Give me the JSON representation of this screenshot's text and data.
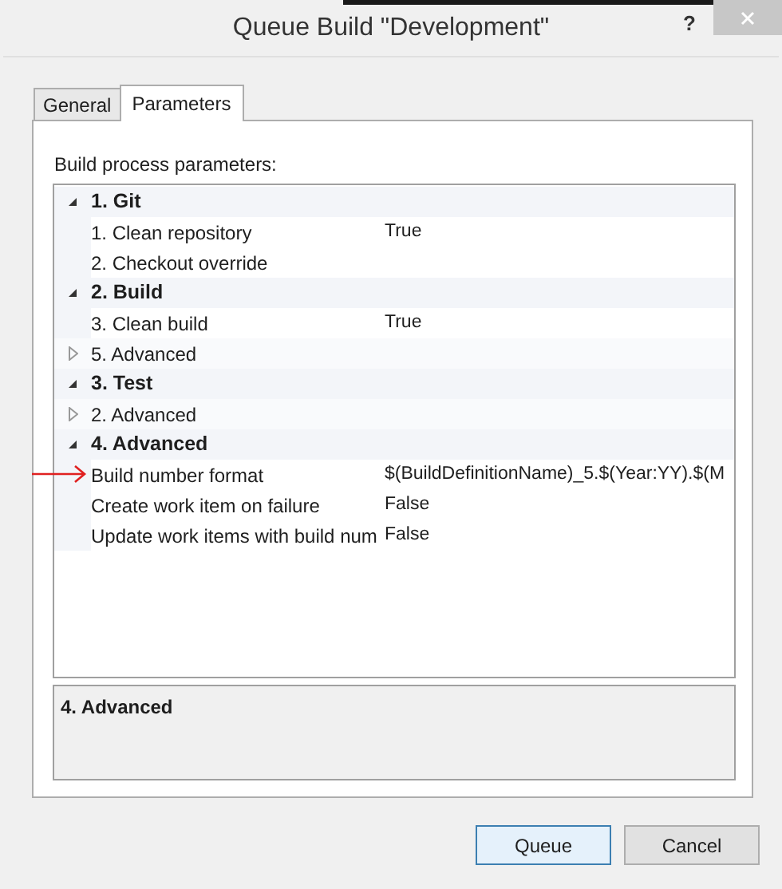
{
  "window": {
    "title": "Queue Build \"Development\"",
    "help": "?"
  },
  "tabs": [
    {
      "label": "General",
      "selected": false
    },
    {
      "label": "Parameters",
      "selected": true
    }
  ],
  "section_label": "Build process parameters:",
  "groups": [
    {
      "label": "1. Git",
      "expanded": true,
      "children": [
        {
          "kind": "param",
          "name": "1. Clean repository",
          "value": "True"
        },
        {
          "kind": "param",
          "name": "2. Checkout override"
        }
      ]
    },
    {
      "label": "2. Build",
      "expanded": true,
      "children": [
        {
          "kind": "param",
          "name": "3. Clean build",
          "value": "True"
        },
        {
          "kind": "group",
          "label": "5. Advanced",
          "expanded": false
        }
      ]
    },
    {
      "label": "3. Test",
      "expanded": true,
      "children": [
        {
          "kind": "group",
          "label": "2. Advanced",
          "expanded": false
        }
      ]
    },
    {
      "label": "4. Advanced",
      "expanded": true,
      "children": [
        {
          "kind": "param",
          "name": "Build number format",
          "value": "$(BuildDefinitionName)_5.$(Year:YY).$(M",
          "annotated": true
        },
        {
          "kind": "param",
          "name": "Create work item on failure",
          "value": "False"
        },
        {
          "kind": "param",
          "name": "Update work items with build num",
          "value": "False"
        }
      ]
    }
  ],
  "description": {
    "title": "4. Advanced"
  },
  "buttons": [
    {
      "label": "Queue",
      "default": true
    },
    {
      "label": "Cancel",
      "default": false
    }
  ]
}
